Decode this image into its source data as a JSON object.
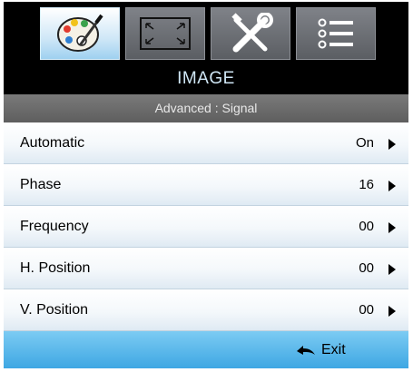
{
  "tabs": [
    {
      "icon": "palette-icon",
      "active": true
    },
    {
      "icon": "screen-frame-icon",
      "active": false
    },
    {
      "icon": "tools-icon",
      "active": false
    },
    {
      "icon": "menu-list-icon",
      "active": false
    }
  ],
  "title": "IMAGE",
  "subtitle": "Advanced : Signal",
  "rows": [
    {
      "label": "Automatic",
      "value": "On"
    },
    {
      "label": "Phase",
      "value": "16"
    },
    {
      "label": "Frequency",
      "value": "00"
    },
    {
      "label": "H. Position",
      "value": "00"
    },
    {
      "label": "V. Position",
      "value": "00"
    }
  ],
  "footer": {
    "exit_label": "Exit",
    "exit_icon": "back-arrow-icon"
  },
  "colors": {
    "accent": "#3ea7e3",
    "active_tab": "#cfe7f7"
  }
}
